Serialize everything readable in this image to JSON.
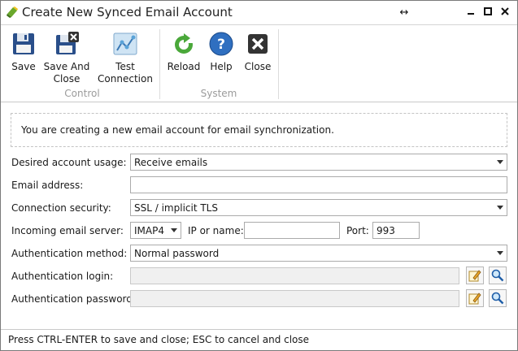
{
  "window": {
    "title": "Create New Synced Email Account",
    "controls": {
      "restore": "↔",
      "minimize": "▁",
      "maximize": "▢",
      "close": "✕"
    }
  },
  "ribbon": {
    "groups": [
      {
        "label": "Control"
      },
      {
        "label": "System"
      }
    ],
    "buttons": {
      "save": {
        "label": "Save",
        "icon": "floppy-disk-icon"
      },
      "save_close": {
        "line1": "Save And",
        "line2": "Close",
        "icon": "floppy-disk-close-icon"
      },
      "test": {
        "line1": "Test",
        "line2": "Connection",
        "icon": "network-test-icon"
      },
      "reload": {
        "label": "Reload",
        "icon": "reload-icon"
      },
      "help": {
        "label": "Help",
        "icon": "help-icon"
      },
      "close": {
        "label": "Close",
        "icon": "close-icon"
      }
    }
  },
  "info": {
    "text": "You are creating a new email account for email synchronization."
  },
  "form": {
    "account_usage": {
      "label": "Desired account usage:",
      "value": "Receive emails"
    },
    "email": {
      "label": "Email address:",
      "value": ""
    },
    "security": {
      "label": "Connection security:",
      "value": "SSL / implicit TLS"
    },
    "incoming": {
      "label": "Incoming email server:",
      "protocol": "IMAP4",
      "ip_label": "IP or name:",
      "ip_value": "",
      "port_label": "Port:",
      "port_value": "993"
    },
    "auth_method": {
      "label": "Authentication method:",
      "value": "Normal password"
    },
    "auth_login": {
      "label": "Authentication login:",
      "value": ""
    },
    "auth_password": {
      "label": "Authentication password:",
      "value": ""
    }
  },
  "status": {
    "text": "Press CTRL-ENTER to save and close; ESC to cancel and close"
  },
  "colors": {
    "accent_blue": "#1e5fb4",
    "green": "#3f9a2f",
    "group_label": "#9b9b9b"
  }
}
